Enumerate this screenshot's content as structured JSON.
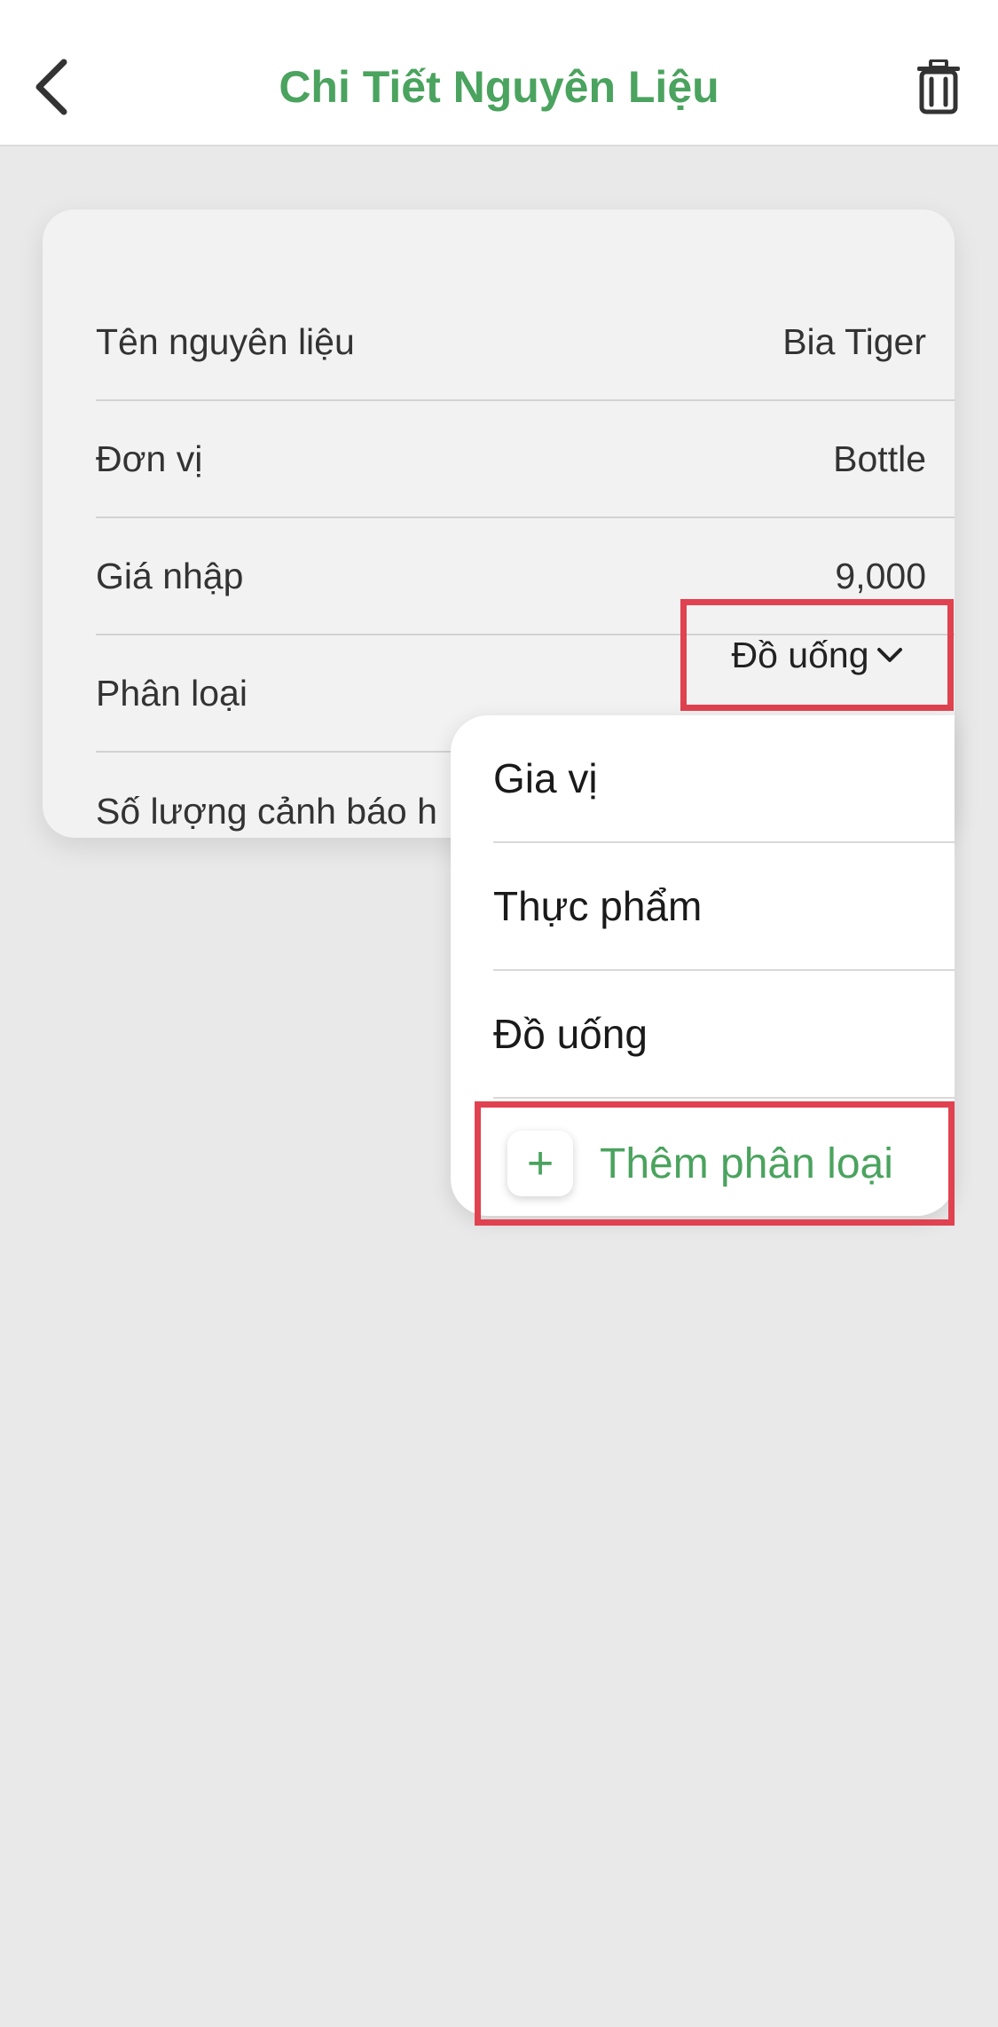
{
  "header": {
    "title": "Chi Tiết Nguyên Liệu",
    "back_icon": "chevron-left-icon",
    "delete_icon": "trash-icon"
  },
  "details": {
    "rows": [
      {
        "label": "Tên nguyên liệu",
        "value": "Bia Tiger"
      },
      {
        "label": "Đơn vị",
        "value": "Bottle"
      },
      {
        "label": "Giá nhập",
        "value": "9,000"
      },
      {
        "label": "Phân loại",
        "value": "Đồ uống"
      },
      {
        "label": "Số lượng cảnh báo h"
      }
    ]
  },
  "dropdown": {
    "options": [
      "Gia vị",
      "Thực phẩm",
      "Đồ uống"
    ],
    "add_label": "Thêm phân loại",
    "add_icon": "+"
  },
  "colors": {
    "accent_green": "#4aa35e",
    "highlight_red": "#e0424f",
    "background": "#e9e9e9",
    "card": "#f2f2f2"
  }
}
